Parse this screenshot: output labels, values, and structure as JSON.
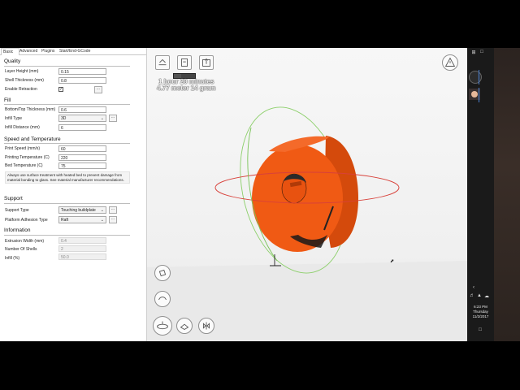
{
  "tabs": [
    "Basic",
    "Advanced",
    "Plugins",
    "Start/End-GCode"
  ],
  "sections": {
    "quality": "Quality",
    "fill": "Fill",
    "speed": "Speed and Temperature",
    "support": "Support",
    "information": "Information"
  },
  "quality": {
    "layer_height_label": "Layer Height (mm)",
    "layer_height": "0.15",
    "shell_thickness_label": "Shell Thickness (mm)",
    "shell_thickness": "0.8",
    "retraction_label": "Enable Retraction",
    "retraction_checked": "✓",
    "more": "..."
  },
  "fill": {
    "bottom_top_label": "Bottom/Top Thickness (mm)",
    "bottom_top": "0.6",
    "infill_type_label": "Infill Type",
    "infill_type": "3D",
    "infill_distance_label": "Infill Distance (mm)",
    "infill_distance": "6",
    "more": "..."
  },
  "speed": {
    "print_speed_label": "Print Speed (mm/s)",
    "print_speed": "60",
    "print_temp_label": "Printing Temperature (C)",
    "print_temp": "220",
    "bed_temp_label": "Bed Temperature (C)",
    "bed_temp": "75",
    "note": "Always use surface treatment with heated bed to prevent damage from material bonding to glass. See material manufacturer recommendations."
  },
  "support": {
    "support_type_label": "Support Type",
    "support_type": "Touching buildplate",
    "adhesion_label": "Platform Adhesion Type",
    "adhesion": "Raft",
    "more": "..."
  },
  "information": {
    "extrusion_width_label": "Extrusion Width (mm)",
    "extrusion_width": "0.4",
    "num_shells_label": "Number Of Shells",
    "num_shells": "2",
    "infill_pct_label": "Infill (%)",
    "infill_pct": "50.0"
  },
  "viewport": {
    "print_time": "1 hour 20 minutes",
    "material": "4.77 meter 14 gram",
    "progress": 0.35,
    "toolbar_icons": [
      "load-icon",
      "save-toolpath-icon",
      "share-icon"
    ],
    "warning_icon": "warning-icon",
    "bottom_icons": [
      "view-mode-icon",
      "rotate-icon",
      "scale-icon",
      "mirror-icon",
      "layer-view-icon"
    ],
    "model_color": "#f05a14"
  },
  "taskbar": {
    "time": "6:23 PM",
    "day": "Thursday",
    "date": "11/2/2017"
  }
}
